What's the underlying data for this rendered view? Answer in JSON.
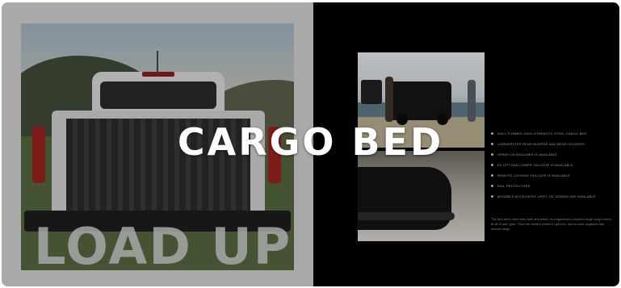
{
  "overlay": {
    "title": "CARGO BED"
  },
  "left_page": {
    "headline": "LOAD UP",
    "photo_alt": "Pickup truck bed with bedliner"
  },
  "right_page": {
    "features": [
      "ROLL-FORMED HIGH-STRENGTH STEEL CARGO BED",
      "CORNERSTEP REAR BUMPER AND BEND HOLDERS",
      "SPRAY-ON BEDLINER IS AVAILABLE",
      "EZ LIFT AND LOWER TAILGATE IS AVAILABLE",
      "REMOTE LOCKING TAILGATE IS AVAILABLE",
      "RAIL PROTECTORS",
      "MOVABLE ACCESSORY UPFIT TIE-DOWNS ARE AVAILABLE"
    ],
    "body_copy": "The bed does more than look and smart. Its engineered Canyon's large cargo bed to fit all of your gear. Then we made it easier to get into, and to load, organize and secure cargo."
  }
}
